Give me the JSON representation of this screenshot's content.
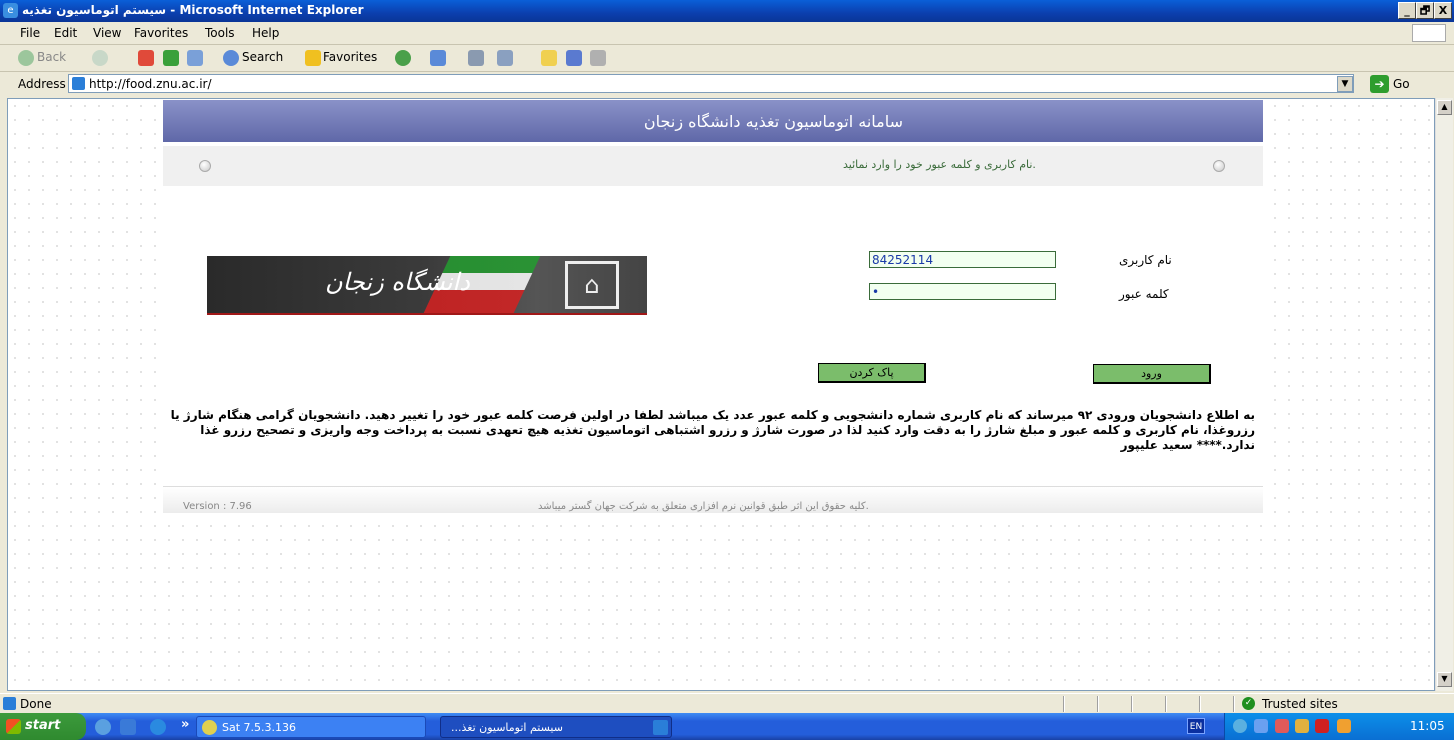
{
  "window": {
    "title": "سیستم اتوماسیون تغذیه - Microsoft Internet Explorer",
    "controls": [
      "_",
      "🗗",
      "X"
    ]
  },
  "menu": [
    {
      "label": "File"
    },
    {
      "label": "Edit"
    },
    {
      "label": "View"
    },
    {
      "label": "Favorites"
    },
    {
      "label": "Tools"
    },
    {
      "label": "Help"
    }
  ],
  "toolbar": {
    "back": "Back",
    "search": "Search",
    "favorites": "Favorites"
  },
  "address": {
    "label": "Address",
    "url": "http://food.znu.ac.ir/",
    "go": "Go"
  },
  "page": {
    "header_title": "سامانه اتوماسیون تغذیه دانشگاه زنجان",
    "info_message": "نام کاربری و کلمه عبور خود را وارد نمائید.",
    "logo_text": "دانشگاه زنجان",
    "username_label": "نام کاربری",
    "username_value": "84252114",
    "password_label": "کلمه عبور",
    "password_value": "•",
    "login_button": "ورود",
    "clear_button": "پاک کردن",
    "notice": "به اطلاع دانشجویان ورودی ۹۲ میرساند که نام کاربری شماره دانشجویی و کلمه عبور عدد یک میباشد لطفا در اولین فرصت کلمه عبور خود را تغییر دهید. دانشجویان گرامی هنگام شارژ یا رزروغذا، نام کاربری و کلمه عبور و مبلغ شارژ را به دقت وارد کنید لذا در صورت شارژ و رزرو اشتباهی اتوماسیون تغذیه هیچ تعهدی نسبت به پرداخت وجه واریزی و تصحیح رزرو غذا ندارد.**** سعید علیپور",
    "version": "Version : 7.96",
    "copyright": "کلیه حقوق این اثر طبق قوانین نرم افزاری متعلق به شرکت جهان گستر میباشد."
  },
  "status": {
    "text": "Done",
    "zone": "Trusted sites"
  },
  "taskbar": {
    "start": "start",
    "chevron": "»",
    "task1": "Sat 7.5.3.136",
    "task2": "...سیستم اتوماسیون تغذ",
    "lang": "EN",
    "clock": "11:05"
  }
}
